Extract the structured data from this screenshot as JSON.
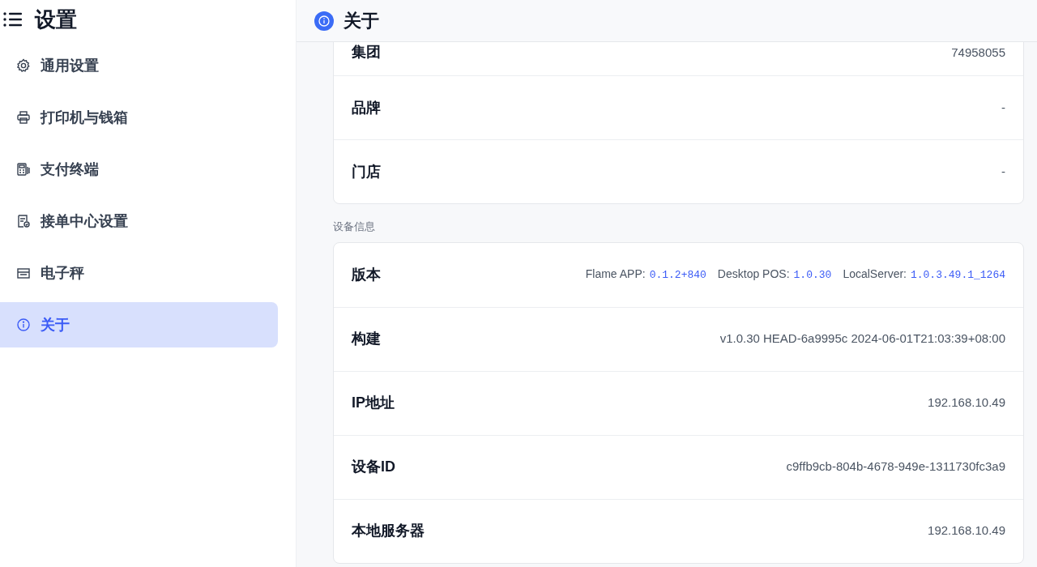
{
  "sidebar": {
    "title": "设置",
    "items": [
      {
        "label": "通用设置",
        "kind": "gear",
        "selected": false
      },
      {
        "label": "打印机与钱箱",
        "kind": "printer",
        "selected": false
      },
      {
        "label": "支付终端",
        "kind": "terminal",
        "selected": false
      },
      {
        "label": "接单中心设置",
        "kind": "doc",
        "selected": false
      },
      {
        "label": "电子秤",
        "kind": "scale",
        "selected": false
      },
      {
        "label": "关于",
        "kind": "info",
        "selected": true
      }
    ]
  },
  "header": {
    "title": "关于"
  },
  "sections": [
    {
      "rows": [
        {
          "label": "集团",
          "value": "74958055"
        },
        {
          "label": "品牌",
          "value": "-"
        },
        {
          "label": "门店",
          "value": "-"
        }
      ]
    },
    {
      "label": "设备信息",
      "rows": [
        {
          "label": "版本",
          "kind": "versions",
          "parts": [
            {
              "name": "Flame APP:",
              "value": "0.1.2+840"
            },
            {
              "name": "Desktop POS:",
              "value": "1.0.30"
            },
            {
              "name": "LocalServer:",
              "value": "1.0.3.49.1_1264"
            }
          ]
        },
        {
          "label": "构建",
          "value": "v1.0.30 HEAD-6a9995c 2024-06-01T21:03:39+08:00"
        },
        {
          "label": "IP地址",
          "value": "192.168.10.49"
        },
        {
          "label": "设备ID",
          "value": "c9ffb9cb-804b-4678-949e-1311730fc3a9"
        },
        {
          "label": "本地服务器",
          "value": "192.168.10.49"
        }
      ]
    }
  ]
}
